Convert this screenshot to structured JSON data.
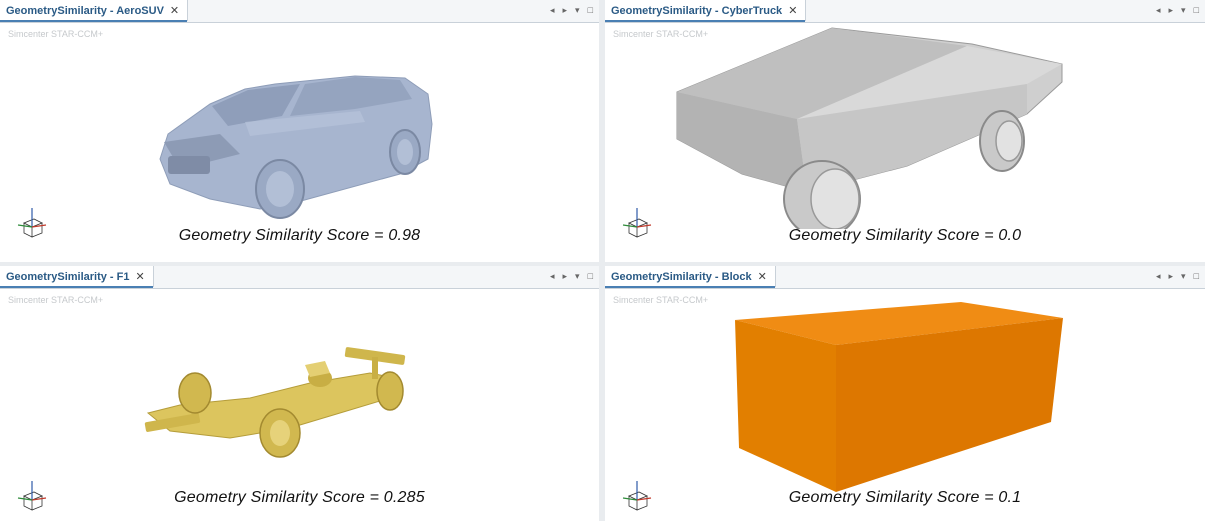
{
  "brand_text": "Simcenter STAR-CCM+",
  "panes": [
    {
      "tab": "GeometrySimilarity - AeroSUV",
      "score": "Geometry Similarity Score = 0.98",
      "model_icon": "suv-model",
      "color": "#a7b5cf"
    },
    {
      "tab": "GeometrySimilarity - CyberTruck",
      "score": "Geometry Similarity Score = 0.0",
      "model_icon": "cybertruck-model",
      "color": "#c8c8c8"
    },
    {
      "tab": "GeometrySimilarity - F1",
      "score": "Geometry Similarity Score = 0.285",
      "model_icon": "f1-car-model",
      "color": "#dcc55e"
    },
    {
      "tab": "GeometrySimilarity - Block",
      "score": "Geometry Similarity Score = 0.1",
      "model_icon": "block-model",
      "color": "#e07a00"
    }
  ],
  "controls": {
    "prev": "◂",
    "next": "▸",
    "menu": "▾",
    "maximize": "□",
    "close": "✕"
  }
}
